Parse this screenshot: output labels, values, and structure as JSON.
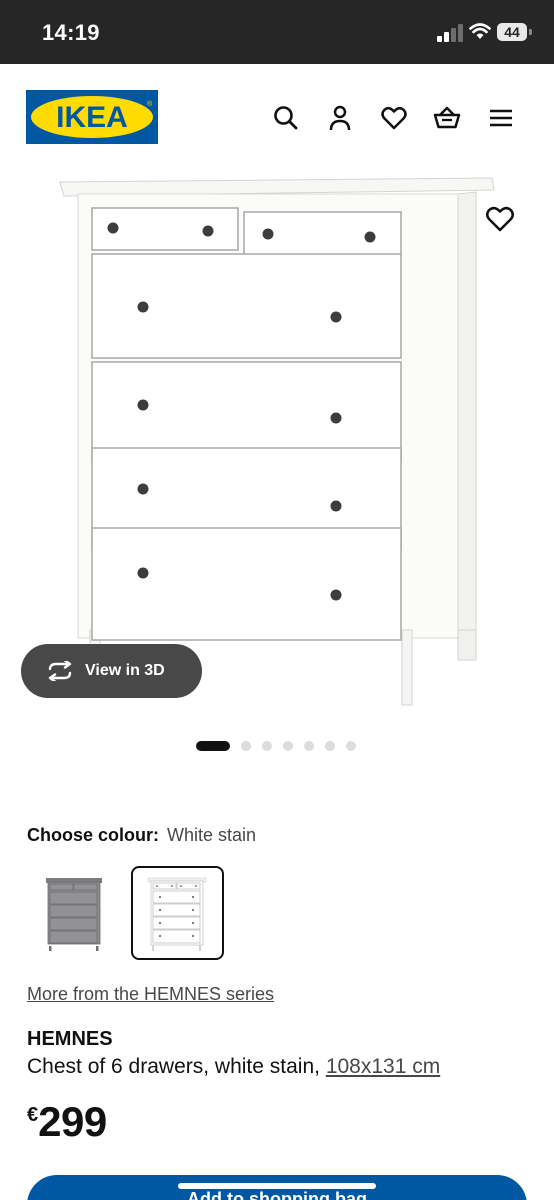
{
  "status_bar": {
    "time": "14:19",
    "battery": "44"
  },
  "header": {
    "logo_text": "IKEA",
    "icons": [
      "search-icon",
      "user-icon",
      "heart-icon",
      "basket-icon",
      "menu-icon"
    ]
  },
  "gallery": {
    "view_3d_label": "View in 3D",
    "image_count": 7,
    "active_index": 0
  },
  "colour": {
    "label": "Choose colour:",
    "selected": "White stain",
    "options": [
      "grey",
      "white"
    ]
  },
  "product": {
    "series_link": "More from the HEMNES series",
    "name": "HEMNES",
    "description": "Chest of 6 drawers, white stain,",
    "dimensions": "108x131 cm",
    "currency": "€",
    "price": "299"
  },
  "actions": {
    "add_to_bag": "Add to shopping bag"
  },
  "colors": {
    "brand_blue": "#0058a3",
    "brand_yellow": "#ffdb00"
  }
}
